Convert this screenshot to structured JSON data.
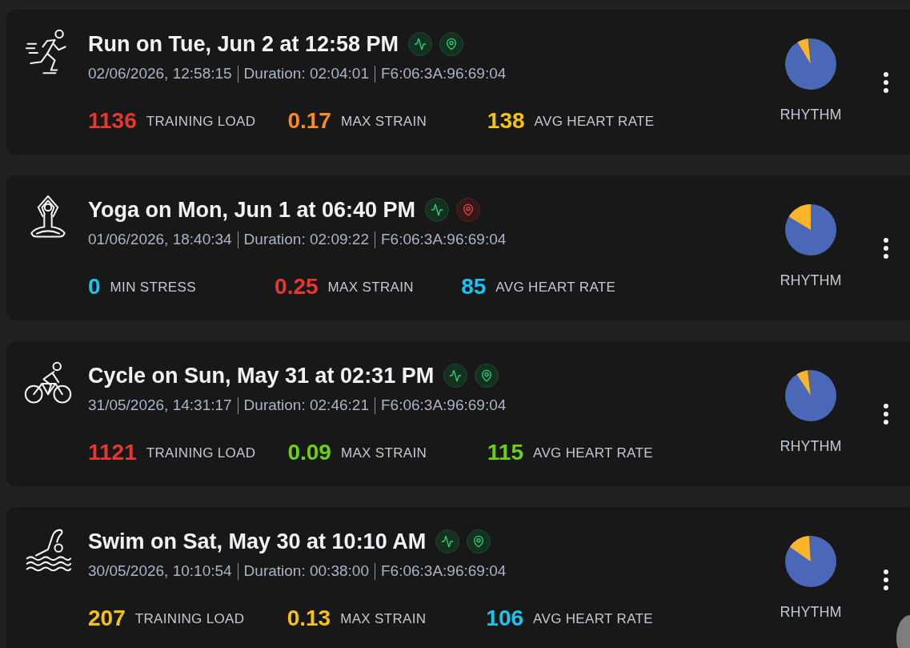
{
  "activities": [
    {
      "kind": "run",
      "title": "Run on Tue, Jun 2 at 12:58 PM",
      "heart_rate_ok": true,
      "location_ok": true,
      "timestamp": "02/06/2026, 12:58:15",
      "duration": "Duration: 02:04:01",
      "device": "F6:06:3A:96:69:04",
      "metrics": [
        {
          "value": "1136",
          "label": "TRAINING LOAD",
          "color": "#e8372f"
        },
        {
          "value": "0.17",
          "label": "MAX STRAIN",
          "color": "#fd8a1e"
        },
        {
          "value": "138",
          "label": "AVG HEART RATE",
          "color": "#f5c211"
        }
      ],
      "chart_label": "RHYTHM"
    },
    {
      "kind": "yoga",
      "title": "Yoga on Mon, Jun 1 at 06:40 PM",
      "heart_rate_ok": true,
      "location_ok": false,
      "timestamp": "01/06/2026, 18:40:34",
      "duration": "Duration: 02:09:22",
      "device": "F6:06:3A:96:69:04",
      "metrics": [
        {
          "value": "0",
          "label": "MIN STRESS",
          "color": "#1cc3ec"
        },
        {
          "value": "0.25",
          "label": "MAX STRAIN",
          "color": "#e8372f"
        },
        {
          "value": "85",
          "label": "AVG HEART RATE",
          "color": "#1cc3ec"
        }
      ],
      "chart_label": "RHYTHM"
    },
    {
      "kind": "cycle",
      "title": "Cycle on Sun, May 31 at 02:31 PM",
      "heart_rate_ok": true,
      "location_ok": true,
      "timestamp": "31/05/2026, 14:31:17",
      "duration": "Duration: 02:46:21",
      "device": "F6:06:3A:96:69:04",
      "metrics": [
        {
          "value": "1121",
          "label": "TRAINING LOAD",
          "color": "#e8372f"
        },
        {
          "value": "0.09",
          "label": "MAX STRAIN",
          "color": "#6bd012"
        },
        {
          "value": "115",
          "label": "AVG HEART RATE",
          "color": "#6bd012"
        }
      ],
      "chart_label": "RHYTHM"
    },
    {
      "kind": "swim",
      "title": "Swim on Sat, May 30 at 10:10 AM",
      "heart_rate_ok": true,
      "location_ok": true,
      "timestamp": "30/05/2026, 10:10:54",
      "duration": "Duration: 00:38:00",
      "device": "F6:06:3A:96:69:04",
      "metrics": [
        {
          "value": "207",
          "label": "TRAINING LOAD",
          "color": "#f5c211"
        },
        {
          "value": "0.13",
          "label": "MAX STRAIN",
          "color": "#f5c211"
        },
        {
          "value": "106",
          "label": "AVG HEART RATE",
          "color": "#1cc3ec"
        }
      ],
      "chart_label": "RHYTHM"
    }
  ]
}
